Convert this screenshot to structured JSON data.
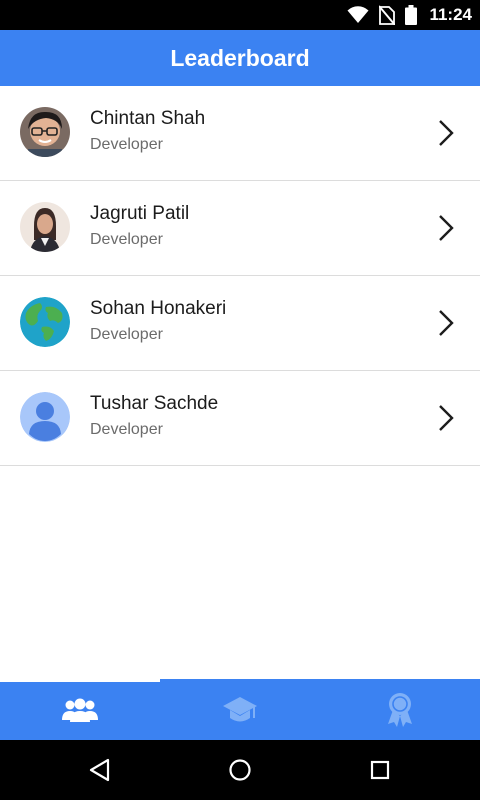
{
  "status_bar": {
    "time": "11:24",
    "icons": [
      "wifi-icon",
      "no-sim-icon",
      "battery-icon"
    ]
  },
  "app_bar": {
    "title": "Leaderboard"
  },
  "leaderboard": {
    "items": [
      {
        "name": "Chintan Shah",
        "role": "Developer",
        "avatar": "photo-avatar"
      },
      {
        "name": "Jagruti Patil",
        "role": "Developer",
        "avatar": "photo-avatar"
      },
      {
        "name": "Sohan Honakeri",
        "role": "Developer",
        "avatar": "globe-avatar"
      },
      {
        "name": "Tushar Sachde",
        "role": "Developer",
        "avatar": "default-person-avatar"
      }
    ]
  },
  "bottom_nav": {
    "tabs": [
      {
        "icon": "people-icon",
        "selected": true
      },
      {
        "icon": "graduation-cap-icon",
        "selected": false
      },
      {
        "icon": "award-ribbon-icon",
        "selected": false
      }
    ]
  },
  "system_nav": {
    "buttons": [
      "back-icon",
      "home-icon",
      "recents-icon"
    ]
  },
  "colors": {
    "primary": "#3b82f2",
    "inactive_icon": "#7fb0f7",
    "divider": "#dcdcdc"
  }
}
